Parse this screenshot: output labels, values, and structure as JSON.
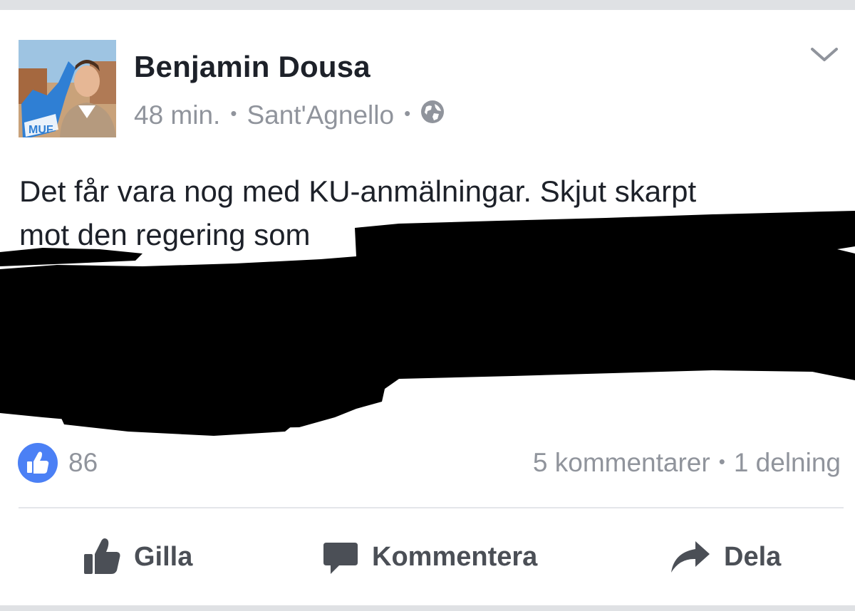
{
  "post": {
    "author": "Benjamin Dousa",
    "time": "48 min.",
    "separator": "•",
    "location": "Sant'Agnello",
    "privacy_icon": "globe-icon",
    "menu_icon": "chevron-down-icon",
    "text_line1": "Det får vara nog med KU-anmälningar. Skjut skarpt",
    "text_line2": "mot den regering som"
  },
  "stats": {
    "like_icon": "thumbs-up-icon",
    "like_count": "86",
    "comments": "5 kommentarer",
    "separator": "•",
    "shares": "1 delning"
  },
  "actions": {
    "like_label": "Gilla",
    "comment_label": "Kommentera",
    "share_label": "Dela"
  },
  "colors": {
    "author": "#1d2129",
    "meta": "#90949c",
    "like_badge": "#4b80f5",
    "action_text": "#4b4f56",
    "redaction": "#000000"
  }
}
